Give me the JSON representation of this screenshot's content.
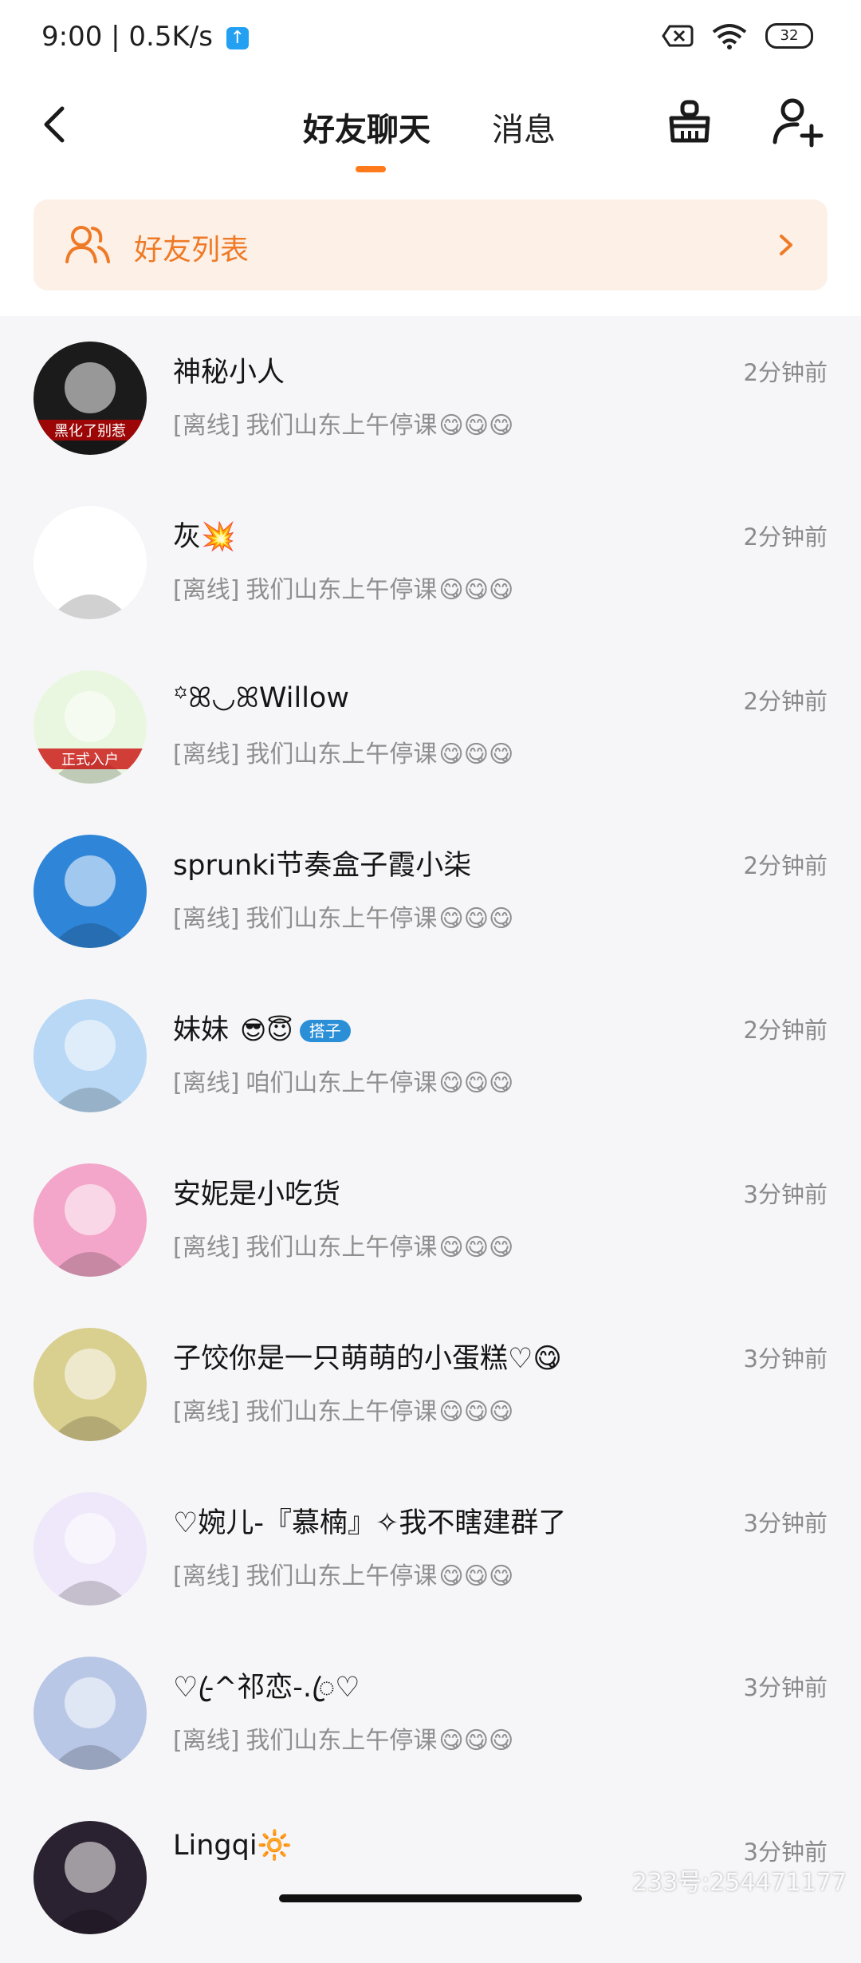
{
  "status_bar": {
    "time": "9:00 | 0.5K/s",
    "upload_icon": "upload-arrow-icon",
    "battery_level": "32"
  },
  "header": {
    "tab_chat": "好友聊天",
    "tab_messages": "消息",
    "active_tab": "好友聊天",
    "accent_color": "#ff7a1a"
  },
  "friend_list_banner": {
    "label": "好友列表"
  },
  "chats": [
    {
      "name": "神秘小人",
      "time": "2分钟前",
      "status": "[离线]",
      "message": "我们山东上午停课",
      "emojis": "😋😋😋",
      "avatar_color": "#1b1b1b",
      "avatar_text": "黑化了别惹"
    },
    {
      "name": "灰💥",
      "time": "2分钟前",
      "status": "[离线]",
      "message": "我们山东上午停课",
      "emojis": "😋😋😋",
      "avatar_color": "#ffffff"
    },
    {
      "name": "꙳ꕤ◡ꕤWillow",
      "time": "2分钟前",
      "status": "[离线]",
      "message": "我们山东上午停课",
      "emojis": "😋😋😋",
      "avatar_color": "#eaf7e0",
      "avatar_text": "正式入户"
    },
    {
      "name": "sprunki节奏盒子霞小柒",
      "time": "2分钟前",
      "status": "[离线]",
      "message": "我们山东上午停课",
      "emojis": "😋😋😋",
      "avatar_color": "#2f86d9"
    },
    {
      "name": "妹妹",
      "time": "2分钟前",
      "status": "[离线]",
      "message": "咱们山东上午停课",
      "emojis": "😋😋😋",
      "avatar_color": "#b8d8f5",
      "tag": "搭子",
      "name_emoji": "😎😇"
    },
    {
      "name": "安妮是小吃货",
      "time": "3分钟前",
      "status": "[离线]",
      "message": "我们山东上午停课",
      "emojis": "😋😋😋",
      "avatar_color": "#f3a6c9"
    },
    {
      "name": "子饺你是一只萌萌的小蛋糕♡😋",
      "time": "3分钟前",
      "status": "[离线]",
      "message": "我们山东上午停课",
      "emojis": "😋😋😋",
      "avatar_color": "#d9cf8e"
    },
    {
      "name": "♡婉儿-『慕楠』✧我不瞎建群了",
      "time": "3分钟前",
      "status": "[离线]",
      "message": "我们山东上午停课",
      "emojis": "😋😋😋",
      "avatar_color": "#efe8fb"
    },
    {
      "name": "♡-ꦿ^祁恋-.ꦿ♡",
      "time": "3分钟前",
      "status": "[离线]",
      "message": "我们山东上午停课",
      "emojis": "😋😋😋",
      "avatar_color": "#b9c7e6"
    },
    {
      "name": "Lingqi🔆",
      "time": "3分钟前",
      "status": "",
      "message": "",
      "emojis": "",
      "avatar_color": "#2a2230"
    }
  ],
  "watermark": "233号:254471177"
}
